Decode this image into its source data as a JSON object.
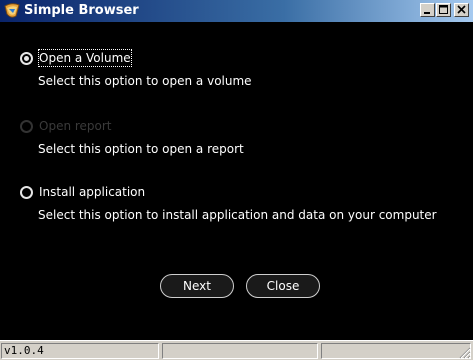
{
  "window": {
    "title": "Simple Browser"
  },
  "options": [
    {
      "label": "Open a Volume",
      "description": "Select this option to open a volume",
      "checked": true,
      "enabled": true
    },
    {
      "label": "Open report",
      "description": "Select this option to open a report",
      "checked": false,
      "enabled": false
    },
    {
      "label": "Install application",
      "description": "Select this option to install application and data on your computer",
      "checked": false,
      "enabled": true
    }
  ],
  "buttons": {
    "next_label": "Next",
    "close_label": "Close"
  },
  "statusbar": {
    "version": "v1.0.4",
    "cell2": "",
    "cell3": ""
  },
  "colors": {
    "background": "#000000",
    "title_gradient_start": "#0a246a",
    "title_gradient_end": "#a6caf0",
    "chrome": "#d4d0c8"
  }
}
